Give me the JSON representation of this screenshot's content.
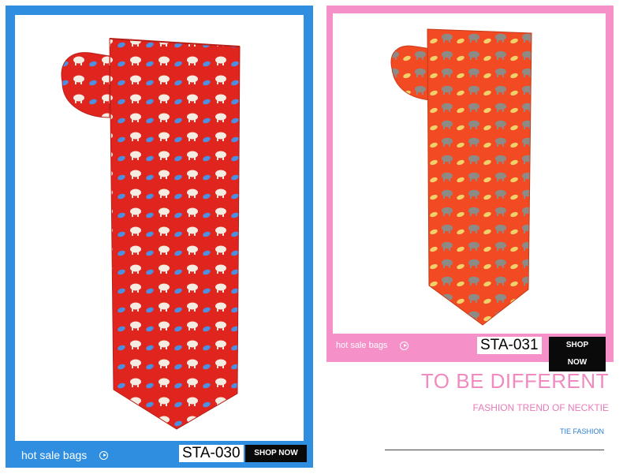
{
  "cards": [
    {
      "id": "left",
      "hot_label": "hot sale bags",
      "code": "STA-030",
      "shop_label": "SHOP NOW",
      "tie_color": "#e0251f",
      "frame_color": "#2f8ee0"
    },
    {
      "id": "right",
      "hot_label": "hot sale bags",
      "code": "STA-031",
      "shop_label": "SHOP NOW",
      "tie_color": "#f24a22",
      "frame_color": "#f590c9"
    }
  ],
  "promo": {
    "headline": "TO BE DIFFERENT",
    "subheadline": "FASHION TREND OF NECKTIE",
    "tag": "TIE FASHION"
  }
}
